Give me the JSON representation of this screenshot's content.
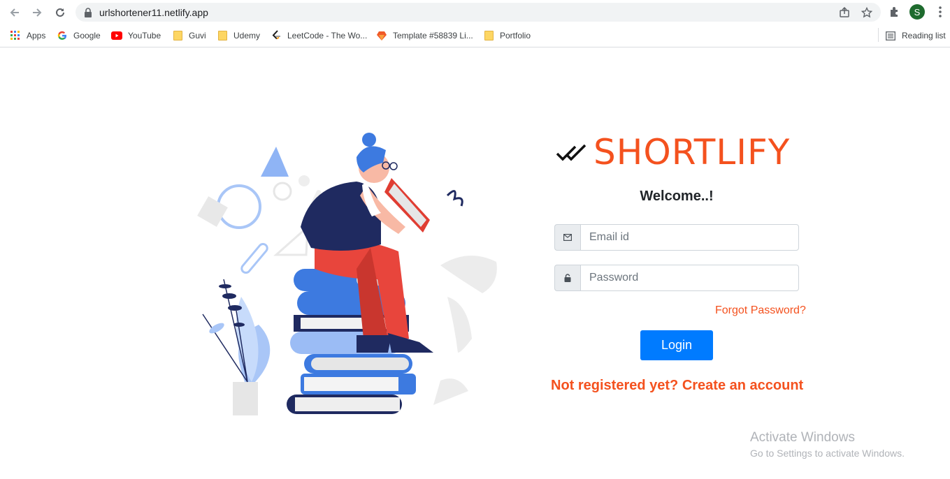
{
  "browser": {
    "url": "urlshortener11.netlify.app",
    "profile_initial": "S",
    "bookmarks": [
      {
        "label": "Apps",
        "icon": "apps-grid-icon"
      },
      {
        "label": "Google",
        "icon": "google-icon"
      },
      {
        "label": "YouTube",
        "icon": "youtube-icon"
      },
      {
        "label": "Guvi",
        "icon": "folder-icon"
      },
      {
        "label": "Udemy",
        "icon": "folder-icon"
      },
      {
        "label": "LeetCode - The Wo...",
        "icon": "leetcode-icon"
      },
      {
        "label": "Template #58839 Li...",
        "icon": "template-icon"
      },
      {
        "label": "Portfolio",
        "icon": "folder-icon"
      }
    ],
    "reading_list": "Reading list"
  },
  "page": {
    "brand": "SHORTLIFY",
    "welcome": "Welcome..!",
    "email_placeholder": "Email id",
    "password_placeholder": "Password",
    "forgot": "Forgot Password?",
    "login": "Login",
    "register": "Not registered yet? Create an account"
  },
  "watermark": {
    "title": "Activate Windows",
    "subtitle": "Go to Settings to activate Windows."
  },
  "colors": {
    "brand": "#f4511e",
    "button": "#007bff"
  }
}
